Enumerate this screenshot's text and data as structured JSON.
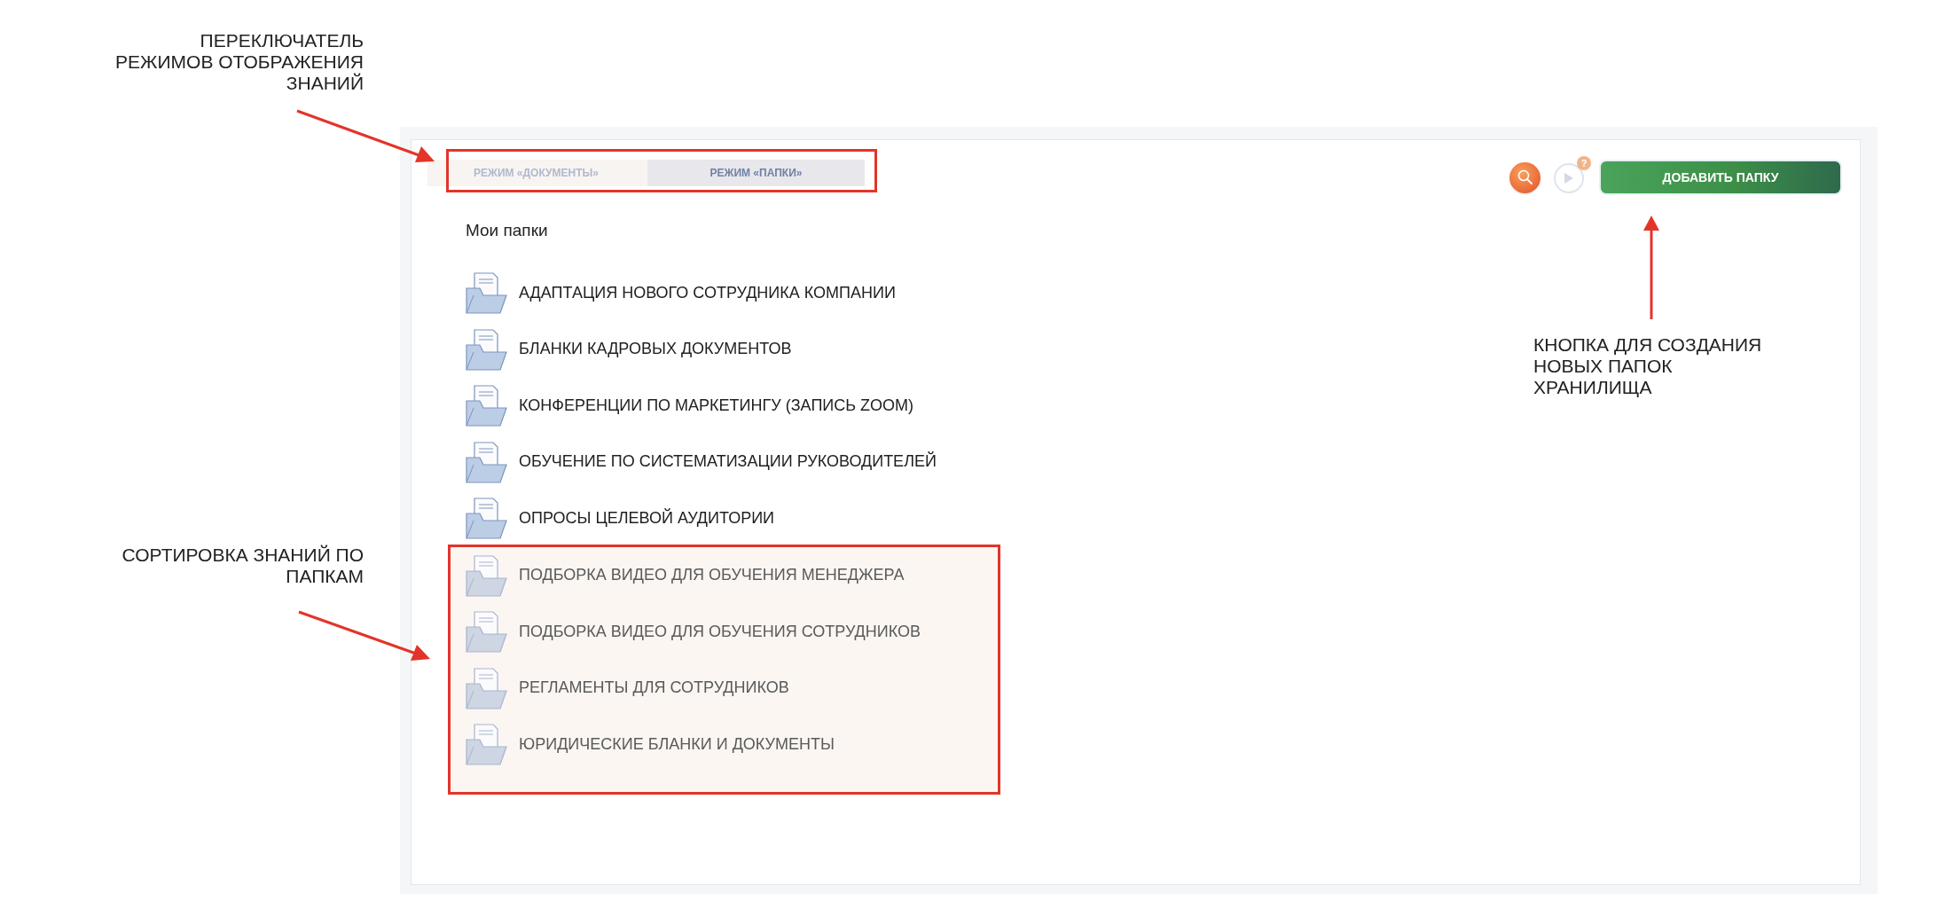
{
  "annotations": [
    {
      "kind": "mode",
      "text": "ПЕРЕКЛЮЧАТЕЛЬ\nРЕЖИМОВ ОТОБРАЖЕНИЯ\nЗНАНИЙ"
    },
    {
      "kind": "sort",
      "text": "СОРТИРОВКА ЗНАНИЙ ПО\nПАПКАМ"
    },
    {
      "kind": "button",
      "text": "КНОПКА ДЛЯ СОЗДАНИЯ\nНОВЫХ ПАПОК\nХРАНИЛИЩА"
    }
  ],
  "tabs": [
    {
      "label": "РЕЖИМ «ДОКУМЕНТЫ»",
      "selected": false
    },
    {
      "label": "РЕЖИМ «ПАПКИ»",
      "selected": true
    }
  ],
  "help_badge": "?",
  "add_button": "ДОБАВИТЬ ПАПКУ",
  "section_title": "Мои папки",
  "folders": [
    {
      "name": "АДАПТАЦИЯ НОВОГО СОТРУДНИКА КОМПАНИИ",
      "highlighted": false
    },
    {
      "name": "БЛАНКИ КАДРОВЫХ ДОКУМЕНТОВ",
      "highlighted": false
    },
    {
      "name": "КОНФЕРЕНЦИИ ПО МАРКЕТИНГУ (ЗАПИСЬ ZOOM)",
      "highlighted": false
    },
    {
      "name": "ОБУЧЕНИЕ ПО СИСТЕМАТИЗАЦИИ РУКОВОДИТЕЛЕЙ",
      "highlighted": false
    },
    {
      "name": "ОПРОСЫ ЦЕЛЕВОЙ АУДИТОРИИ",
      "highlighted": false
    },
    {
      "name": "ПОДБОРКА ВИДЕО ДЛЯ ОБУЧЕНИЯ МЕНЕДЖЕРА",
      "highlighted": true
    },
    {
      "name": "ПОДБОРКА ВИДЕО ДЛЯ ОБУЧЕНИЯ СОТРУДНИКОВ",
      "highlighted": true
    },
    {
      "name": "РЕГЛАМЕНТЫ ДЛЯ СОТРУДНИКОВ",
      "highlighted": true
    },
    {
      "name": "ЮРИДИЧЕСКИЕ БЛАНКИ И ДОКУМЕНТЫ",
      "highlighted": true
    }
  ]
}
